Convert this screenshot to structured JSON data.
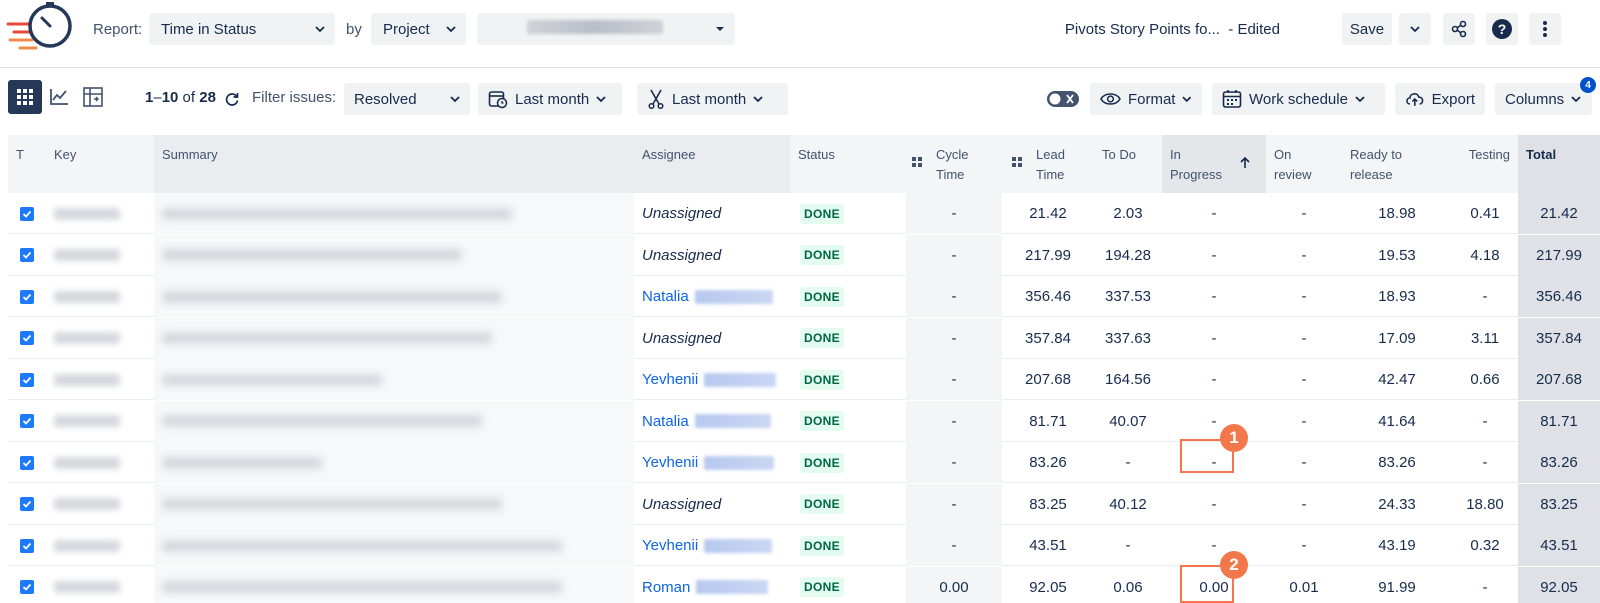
{
  "header": {
    "report_label": "Report:",
    "report_value": "Time in Status",
    "by_label": "by",
    "by_value": "Project",
    "title": "Pivots Story Points fo...",
    "edited": "- Edited",
    "save_label": "Save"
  },
  "toolbar": {
    "range_start": "1",
    "range_end": "10",
    "of_label": "of",
    "total": "28",
    "filter_label": "Filter issues:",
    "filter_value": "Resolved",
    "date1": "Last month",
    "date2": "Last month",
    "format_label": "Format",
    "schedule_label": "Work schedule",
    "export_label": "Export",
    "columns_label": "Columns",
    "columns_badge": "4"
  },
  "columns": {
    "t": "T",
    "key": "Key",
    "summary": "Summary",
    "assignee": "Assignee",
    "status": "Status",
    "cycle1": "Cycle",
    "cycle2": "Time",
    "lead1": "Lead",
    "lead2": "Time",
    "todo": "To Do",
    "inprog1": "In",
    "inprog2": "Progress",
    "review1": "On",
    "review2": "review",
    "ready1": "Ready to",
    "ready2": "release",
    "testing": "Testing",
    "total": "Total"
  },
  "rows": [
    {
      "assignee": "Unassigned",
      "linked": false,
      "status": "DONE",
      "cycle": "-",
      "lead": "21.42",
      "todo": "2.03",
      "inprog": "-",
      "review": "-",
      "ready": "18.98",
      "testing": "0.41",
      "total": "21.42"
    },
    {
      "assignee": "Unassigned",
      "linked": false,
      "status": "DONE",
      "cycle": "-",
      "lead": "217.99",
      "todo": "194.28",
      "inprog": "-",
      "review": "-",
      "ready": "19.53",
      "testing": "4.18",
      "total": "217.99"
    },
    {
      "assignee": "Natalia",
      "linked": true,
      "status": "DONE",
      "cycle": "-",
      "lead": "356.46",
      "todo": "337.53",
      "inprog": "-",
      "review": "-",
      "ready": "18.93",
      "testing": "-",
      "total": "356.46"
    },
    {
      "assignee": "Unassigned",
      "linked": false,
      "status": "DONE",
      "cycle": "-",
      "lead": "357.84",
      "todo": "337.63",
      "inprog": "-",
      "review": "-",
      "ready": "17.09",
      "testing": "3.11",
      "total": "357.84"
    },
    {
      "assignee": "Yevhenii",
      "linked": true,
      "status": "DONE",
      "cycle": "-",
      "lead": "207.68",
      "todo": "164.56",
      "inprog": "-",
      "review": "-",
      "ready": "42.47",
      "testing": "0.66",
      "total": "207.68"
    },
    {
      "assignee": "Natalia",
      "linked": true,
      "status": "DONE",
      "cycle": "-",
      "lead": "81.71",
      "todo": "40.07",
      "inprog": "-",
      "review": "-",
      "ready": "41.64",
      "testing": "-",
      "total": "81.71"
    },
    {
      "assignee": "Yevhenii",
      "linked": true,
      "status": "DONE",
      "cycle": "-",
      "lead": "83.26",
      "todo": "-",
      "inprog": "-",
      "review": "-",
      "ready": "83.26",
      "testing": "-",
      "total": "83.26"
    },
    {
      "assignee": "Unassigned",
      "linked": false,
      "status": "DONE",
      "cycle": "-",
      "lead": "83.25",
      "todo": "40.12",
      "inprog": "-",
      "review": "-",
      "ready": "24.33",
      "testing": "18.80",
      "total": "83.25"
    },
    {
      "assignee": "Yevhenii",
      "linked": true,
      "status": "DONE",
      "cycle": "-",
      "lead": "43.51",
      "todo": "-",
      "inprog": "-",
      "review": "-",
      "ready": "43.19",
      "testing": "0.32",
      "total": "43.51"
    },
    {
      "assignee": "Roman",
      "linked": true,
      "status": "DONE",
      "cycle": "0.00",
      "lead": "92.05",
      "todo": "0.06",
      "inprog": "0.00",
      "review": "0.01",
      "ready": "91.99",
      "testing": "-",
      "total": "92.05"
    }
  ],
  "annotations": {
    "marker1": "1",
    "marker2": "2"
  },
  "colors": {
    "accent": "#0052cc",
    "done_bg": "#e3fcef",
    "done_text": "#006644",
    "marker": "#f2784b"
  },
  "icons": [
    "logo-stopwatch-icon",
    "chevron-down-icon",
    "share-icon",
    "help-icon",
    "more-icon",
    "grid-view-icon",
    "chart-view-icon",
    "pivot-view-icon",
    "refresh-icon",
    "calendar-icon",
    "scissors-icon",
    "toggle-icon",
    "eye-icon",
    "schedule-icon",
    "cloud-export-icon",
    "sort-up-icon",
    "drag-icon",
    "checkbox-icon"
  ]
}
